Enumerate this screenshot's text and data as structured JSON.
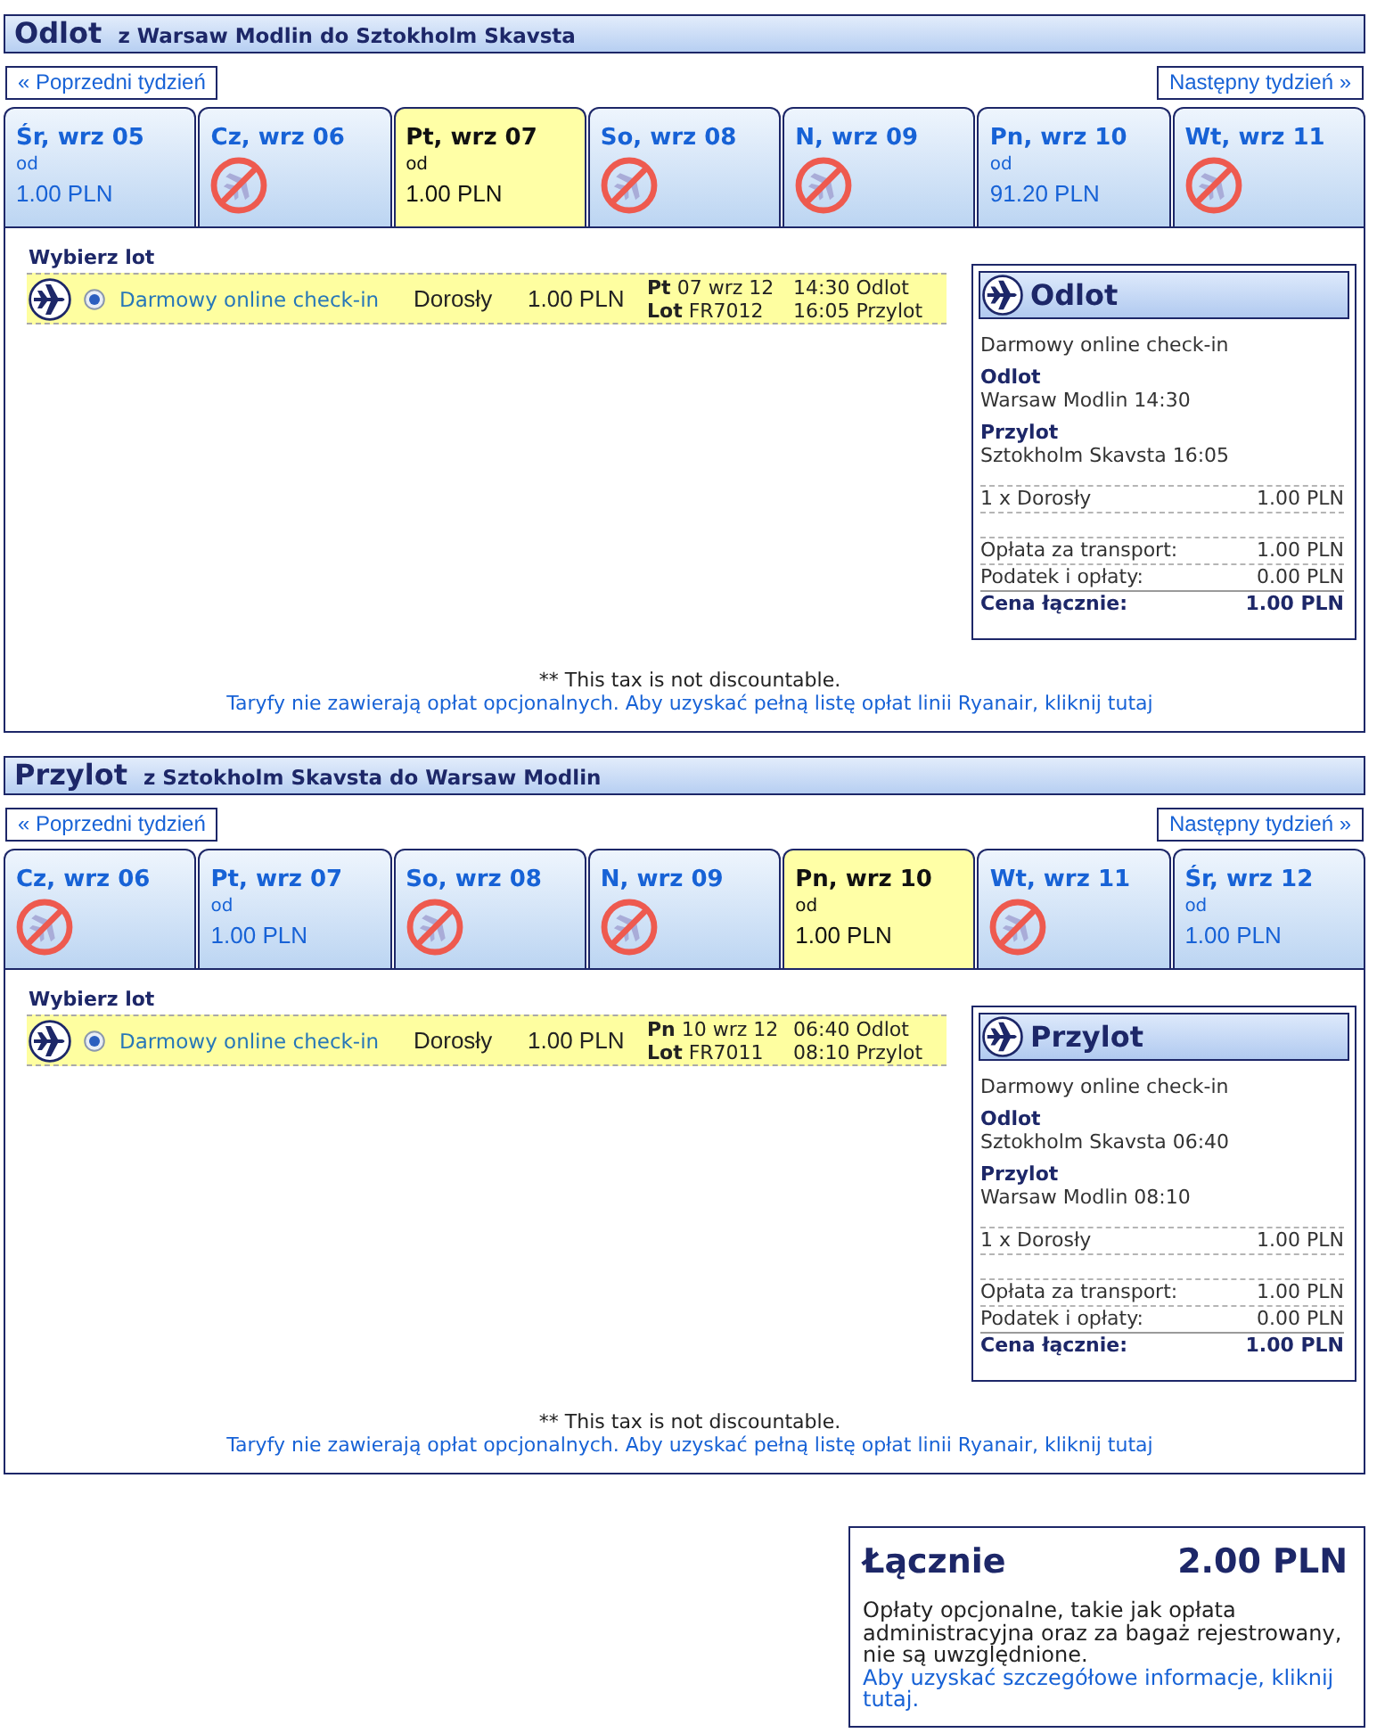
{
  "sections": [
    {
      "title": "Odlot",
      "route": "z Warsaw Modlin do Sztokholm Skavsta",
      "prev_week": "« Poprzedni tydzień",
      "next_week": "Następny tydzień »",
      "days": [
        {
          "label": "Śr, wrz 05",
          "available": true,
          "from_label": "od",
          "price": "1.00 PLN",
          "selected": false
        },
        {
          "label": "Cz, wrz 06",
          "available": false,
          "selected": false
        },
        {
          "label": "Pt, wrz 07",
          "available": true,
          "from_label": "od",
          "price": "1.00 PLN",
          "selected": true
        },
        {
          "label": "So, wrz 08",
          "available": false,
          "selected": false
        },
        {
          "label": "N, wrz 09",
          "available": false,
          "selected": false
        },
        {
          "label": "Pn, wrz 10",
          "available": true,
          "from_label": "od",
          "price": "91.20 PLN",
          "selected": false
        },
        {
          "label": "Wt, wrz 11",
          "available": false,
          "selected": false
        }
      ],
      "select_heading": "Wybierz lot",
      "flights": [
        {
          "selected": true,
          "fare": "Darmowy online check-in",
          "passenger": "Dorosły",
          "price": "1.00 PLN",
          "date": "**Pt** 07 wrz 12",
          "flight_no": "**Lot** FR7012",
          "departure": "14:30 Odlot",
          "arrival": "16:05 Przylot"
        }
      ],
      "summary": {
        "title": "Odlot",
        "fare": "Darmowy online check-in",
        "departure_label": "Odlot",
        "departure": "Warsaw Modlin 14:30",
        "arrival_label": "Przylot",
        "arrival": "Sztokholm Skavsta 16:05",
        "passenger_line": {
          "label": "1 x Dorosły",
          "amount": "1.00 PLN"
        },
        "charges": [
          {
            "label": "Opłata za transport:",
            "amount": "1.00 PLN"
          },
          {
            "label": "Podatek i opłaty:",
            "amount": "0.00 PLN"
          }
        ],
        "total": {
          "label": "Cena łącznie:",
          "amount": "1.00 PLN"
        }
      },
      "tax_note": "** This tax is not discountable.",
      "fees_link": "Taryfy nie zawierają opłat opcjonalnych. Aby uzyskać pełną listę opłat linii Ryanair, kliknij tutaj"
    },
    {
      "title": "Przylot",
      "route": "z Sztokholm Skavsta do Warsaw Modlin",
      "prev_week": "« Poprzedni tydzień",
      "next_week": "Następny tydzień »",
      "days": [
        {
          "label": "Cz, wrz 06",
          "available": false,
          "selected": false
        },
        {
          "label": "Pt, wrz 07",
          "available": true,
          "from_label": "od",
          "price": "1.00 PLN",
          "selected": false
        },
        {
          "label": "So, wrz 08",
          "available": false,
          "selected": false
        },
        {
          "label": "N, wrz 09",
          "available": false,
          "selected": false
        },
        {
          "label": "Pn, wrz 10",
          "available": true,
          "from_label": "od",
          "price": "1.00 PLN",
          "selected": true
        },
        {
          "label": "Wt, wrz 11",
          "available": false,
          "selected": false
        },
        {
          "label": "Śr, wrz 12",
          "available": true,
          "from_label": "od",
          "price": "1.00 PLN",
          "selected": false
        }
      ],
      "select_heading": "Wybierz lot",
      "flights": [
        {
          "selected": true,
          "fare": "Darmowy online check-in",
          "passenger": "Dorosły",
          "price": "1.00 PLN",
          "date": "**Pn** 10 wrz 12",
          "flight_no": "**Lot** FR7011",
          "departure": "06:40 Odlot",
          "arrival": "08:10 Przylot"
        }
      ],
      "summary": {
        "title": "Przylot",
        "fare": "Darmowy online check-in",
        "departure_label": "Odlot",
        "departure": "Sztokholm Skavsta 06:40",
        "arrival_label": "Przylot",
        "arrival": "Warsaw Modlin 08:10",
        "passenger_line": {
          "label": "1 x Dorosły",
          "amount": "1.00 PLN"
        },
        "charges": [
          {
            "label": "Opłata za transport:",
            "amount": "1.00 PLN"
          },
          {
            "label": "Podatek i opłaty:",
            "amount": "0.00 PLN"
          }
        ],
        "total": {
          "label": "Cena łącznie:",
          "amount": "1.00 PLN"
        }
      },
      "tax_note": "** This tax is not discountable.",
      "fees_link": "Taryfy nie zawierają opłat opcjonalnych. Aby uzyskać pełną listę opłat linii Ryanair, kliknij tutaj"
    }
  ],
  "grand_total": {
    "label": "Łącznie",
    "amount": "2.00 PLN",
    "note": "Opłaty opcjonalne, takie jak opłata administracyjna oraz za bagaż rejestrowany, nie są uwzględnione.",
    "link": "Aby uzyskać szczegółowe informacje, kliknij tutaj."
  }
}
